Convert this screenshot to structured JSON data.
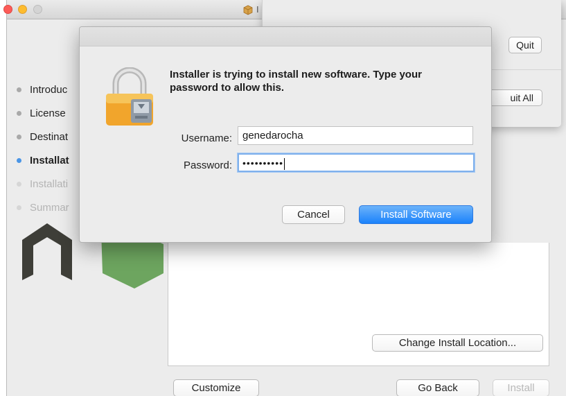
{
  "window": {
    "title_partial": "I",
    "steps": [
      {
        "label": "Introduc",
        "state": "done"
      },
      {
        "label": "License",
        "state": "done"
      },
      {
        "label": "Destinat",
        "state": "done"
      },
      {
        "label": "Installat",
        "state": "current"
      },
      {
        "label": "Installati",
        "state": "future"
      },
      {
        "label": "Summar",
        "state": "future"
      }
    ],
    "buttons": {
      "change_location": "Change Install Location...",
      "customize": "Customize",
      "go_back": "Go Back",
      "install": "Install"
    }
  },
  "quit_window": {
    "quit": "Quit",
    "quit_all": "uit All"
  },
  "dialog": {
    "message": "Installer is trying to install new software. Type your password to allow this.",
    "username_label": "Username:",
    "username_value": "genedarocha",
    "password_label": "Password:",
    "password_masked": "••••••••••",
    "cancel": "Cancel",
    "install_software": "Install Software"
  },
  "colors": {
    "accent": "#1a82fb",
    "current_step": "#4a95e6",
    "node_dark": "#3e3e38",
    "node_green": "#6da55f",
    "lock_gold": "#f1a52c"
  },
  "icons": {
    "lock": "lock-icon",
    "package": "package-icon"
  }
}
